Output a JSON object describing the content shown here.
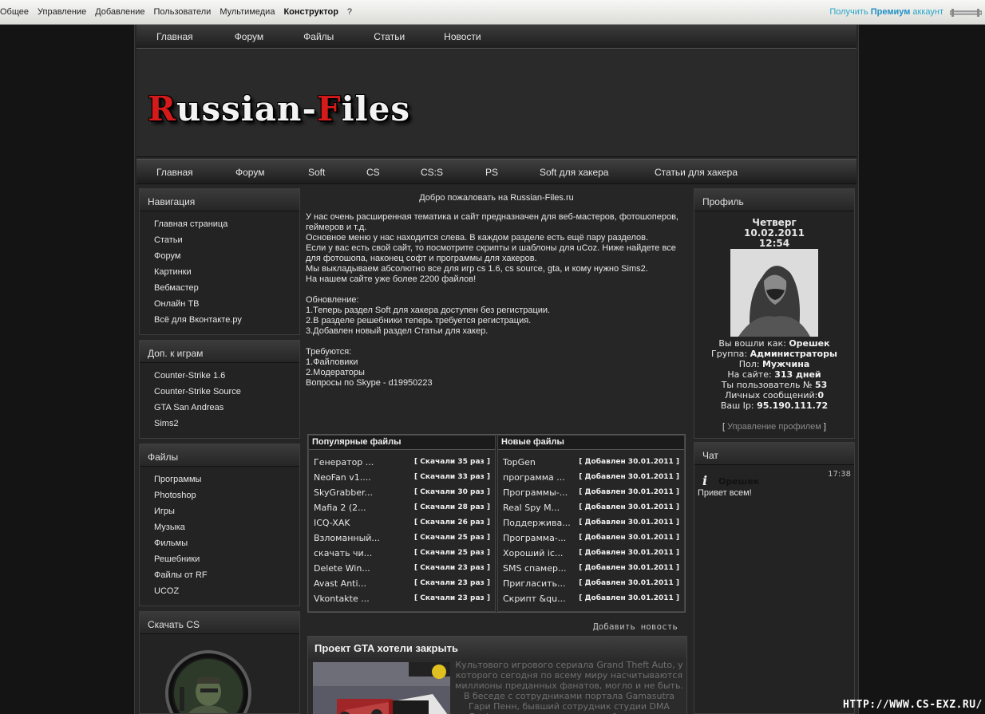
{
  "adminbar": {
    "menu": [
      "Общее",
      "Управление",
      "Добавление",
      "Пользователи",
      "Мультимедиа",
      "Конструктор",
      "?"
    ],
    "premium_prefix": "Получить ",
    "premium_bold": "Премиум",
    "premium_suffix": " аккаунт"
  },
  "topnav": [
    "Главная",
    "Форум",
    "Файлы",
    "Статьи",
    "Новости"
  ],
  "logo": {
    "part1_red": "R",
    "part1": "ussian-",
    "part2_red": "F",
    "part2": "iles"
  },
  "subnav": [
    "Главная",
    "Форум",
    "Soft",
    "CS",
    "CS:S",
    "PS",
    "Soft для хакера",
    "Статьи для хакера"
  ],
  "left": {
    "navigation": {
      "title": "Навигация",
      "items": [
        "Главная страница",
        "Статьи",
        "Форум",
        "Картинки",
        "Вебмастер",
        "Онлайн ТВ",
        "Всё для Вконтакте.ру"
      ]
    },
    "games": {
      "title": "Доп. к играм",
      "items": [
        "Counter-Strike 1.6",
        "Counter-Strike Source",
        "GTA San Andreas",
        "Sims2"
      ]
    },
    "files": {
      "title": "Файлы",
      "items": [
        "Программы",
        "Photoshop",
        "Игры",
        "Музыка",
        "Фильмы",
        "Решебники",
        "Файлы от RF",
        "UCOZ"
      ]
    },
    "download_cs": {
      "title": "Скачать CS"
    }
  },
  "center": {
    "welcome": "Добро пожаловать на Russian-Files.ru",
    "intro": "У нас очень расширенная тематика и сайт предназначен для веб-мастеров, фотошоперов, геймеров и т.д.\nОсновное меню у нас находится слева. В каждом разделе есть ещё пару разделов.\nЕсли у вас есть свой сайт, то посмотрите скрипты и шаблоны для uCoz. Ниже найдете все для фотошопа, наконец софт и программы для хакеров.\nМы выкладываем абсолютно все для игр cs 1.6, cs source, gta, и кому нужно Sims2.\nНа нашем сайте уже более 2200 файлов!\n\nОбновление:\n1.Теперь раздел Soft для хакера доступен без регистрации.\n2.В разделе решебники теперь требуется регистрация.\n3.Добавлен новый раздел Статьи для хакер.\n\nТребуются:\n1.Файловики\n2.Модераторы\nВопросы по Skype - d19950223",
    "popular": {
      "title": "Популярные файлы",
      "rows": [
        {
          "name": "Генератор ...",
          "stat": "[ Скачали 35 раз ]"
        },
        {
          "name": "NeoFan v1....",
          "stat": "[ Скачали 33 раз ]"
        },
        {
          "name": "SkyGrabber...",
          "stat": "[ Скачали 30 раз ]"
        },
        {
          "name": "Mafia 2 (2...",
          "stat": "[ Скачали 28 раз ]"
        },
        {
          "name": "ICQ-XAK",
          "stat": "[ Скачали 26 раз ]"
        },
        {
          "name": "Взломанный...",
          "stat": "[ Скачали 25 раз ]"
        },
        {
          "name": "скачать чи...",
          "stat": "[ Скачали 25 раз ]"
        },
        {
          "name": "Delete Win...",
          "stat": "[ Скачали 23 раз ]"
        },
        {
          "name": "Avast Anti...",
          "stat": "[ Скачали 23 раз ]"
        },
        {
          "name": "Vkontakte ...",
          "stat": "[ Скачали 23 раз ]"
        }
      ]
    },
    "newest": {
      "title": "Новые файлы",
      "rows": [
        {
          "name": "TopGen",
          "stat": "[ Добавлен 30.01.2011 ]"
        },
        {
          "name": "программа ...",
          "stat": "[ Добавлен 30.01.2011 ]"
        },
        {
          "name": "Программы-...",
          "stat": "[ Добавлен 30.01.2011 ]"
        },
        {
          "name": "Real Spy M...",
          "stat": "[ Добавлен 30.01.2011 ]"
        },
        {
          "name": "Поддержива...",
          "stat": "[ Добавлен 30.01.2011 ]"
        },
        {
          "name": "Программа-...",
          "stat": "[ Добавлен 30.01.2011 ]"
        },
        {
          "name": "Хороший ic...",
          "stat": "[ Добавлен 30.01.2011 ]"
        },
        {
          "name": "SMS спамер...",
          "stat": "[ Добавлен 30.01.2011 ]"
        },
        {
          "name": "Пригласить...",
          "stat": "[ Добавлен 30.01.2011 ]"
        },
        {
          "name": "Скрипт &qu...",
          "stat": "[ Добавлен 30.01.2011 ]"
        }
      ]
    },
    "add_news": "Добавить новость",
    "news": {
      "title": "Проект GTA хотели закрыть",
      "text": "Культового игрового сериала Grand Theft Auto, у которого сегодня по всему миру насчитываются миллионы преданных фанатов, могло и не быть. В беседе с сотрудниками портала Gamasutra Гари Пенн, бывший сотрудник студии DMA Designs, признался, что в какой-то момент разработчики вообще хотели отменить выход первой GTA."
    }
  },
  "profile": {
    "title": "Профиль",
    "day": "Четверг",
    "date": "10.02.2011",
    "time": "12:54",
    "lines": [
      {
        "label": "Вы вошли как: ",
        "value": "Орешек"
      },
      {
        "label": "Группа: ",
        "value": "Администраторы"
      },
      {
        "label": "Пол: ",
        "value": "Мужчина"
      },
      {
        "label": "На сайте: ",
        "value": "313 дней"
      },
      {
        "label": "Ты пользователь № ",
        "value": "53"
      },
      {
        "label": "Личных сообщений:",
        "value": "0"
      },
      {
        "label": "Ваш Ip: ",
        "value": "95.190.111.72"
      }
    ],
    "manage_open": "[ ",
    "manage": "Управление профилем",
    "manage_close": " ]"
  },
  "chat": {
    "title": "Чат",
    "time": "17:38",
    "user": "Орешек",
    "text": "Привет всем!"
  },
  "watermark": "HTTP://WWW.CS-EXZ.RU/",
  "colors": {
    "logo_red": "#d41a1a",
    "premium": "#1e90c6",
    "bg": "#141414",
    "panel": "#262626"
  }
}
